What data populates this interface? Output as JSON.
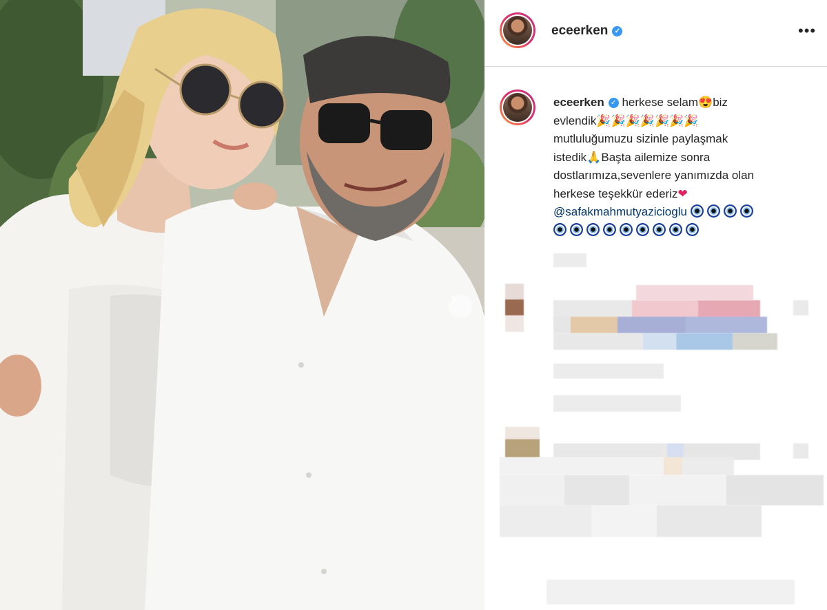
{
  "post": {
    "username": "eceerken",
    "verified_icon": "verified-badge-icon",
    "more_options_label": "•••",
    "caption": {
      "username": "eceerken",
      "line1": "herkese selam",
      "line1b": "biz",
      "line2": "evlendik",
      "line3": "mutluluğumuzu sizinle paylaşmak",
      "line4": "istedik",
      "line4b": "Başta ailemize sonra",
      "line5": "dostlarımıza,sevenlere yanımızda olan",
      "line6": "herkese teşekkür ederiz",
      "mention": "@safakmahmutyazicioglu",
      "emoji_heart_eyes": "😍",
      "emoji_party": "🎉",
      "emoji_pray": "🙏",
      "emoji_heart": "❤"
    }
  },
  "icons": {
    "carousel_next": "chevron-right-icon",
    "more": "more-options-icon"
  },
  "colors": {
    "accent_blue": "#3897f0",
    "mention": "#00376b",
    "story_ring_start": "#f9a13d",
    "story_ring_end": "#c13584",
    "divider": "#dbdbdb"
  }
}
